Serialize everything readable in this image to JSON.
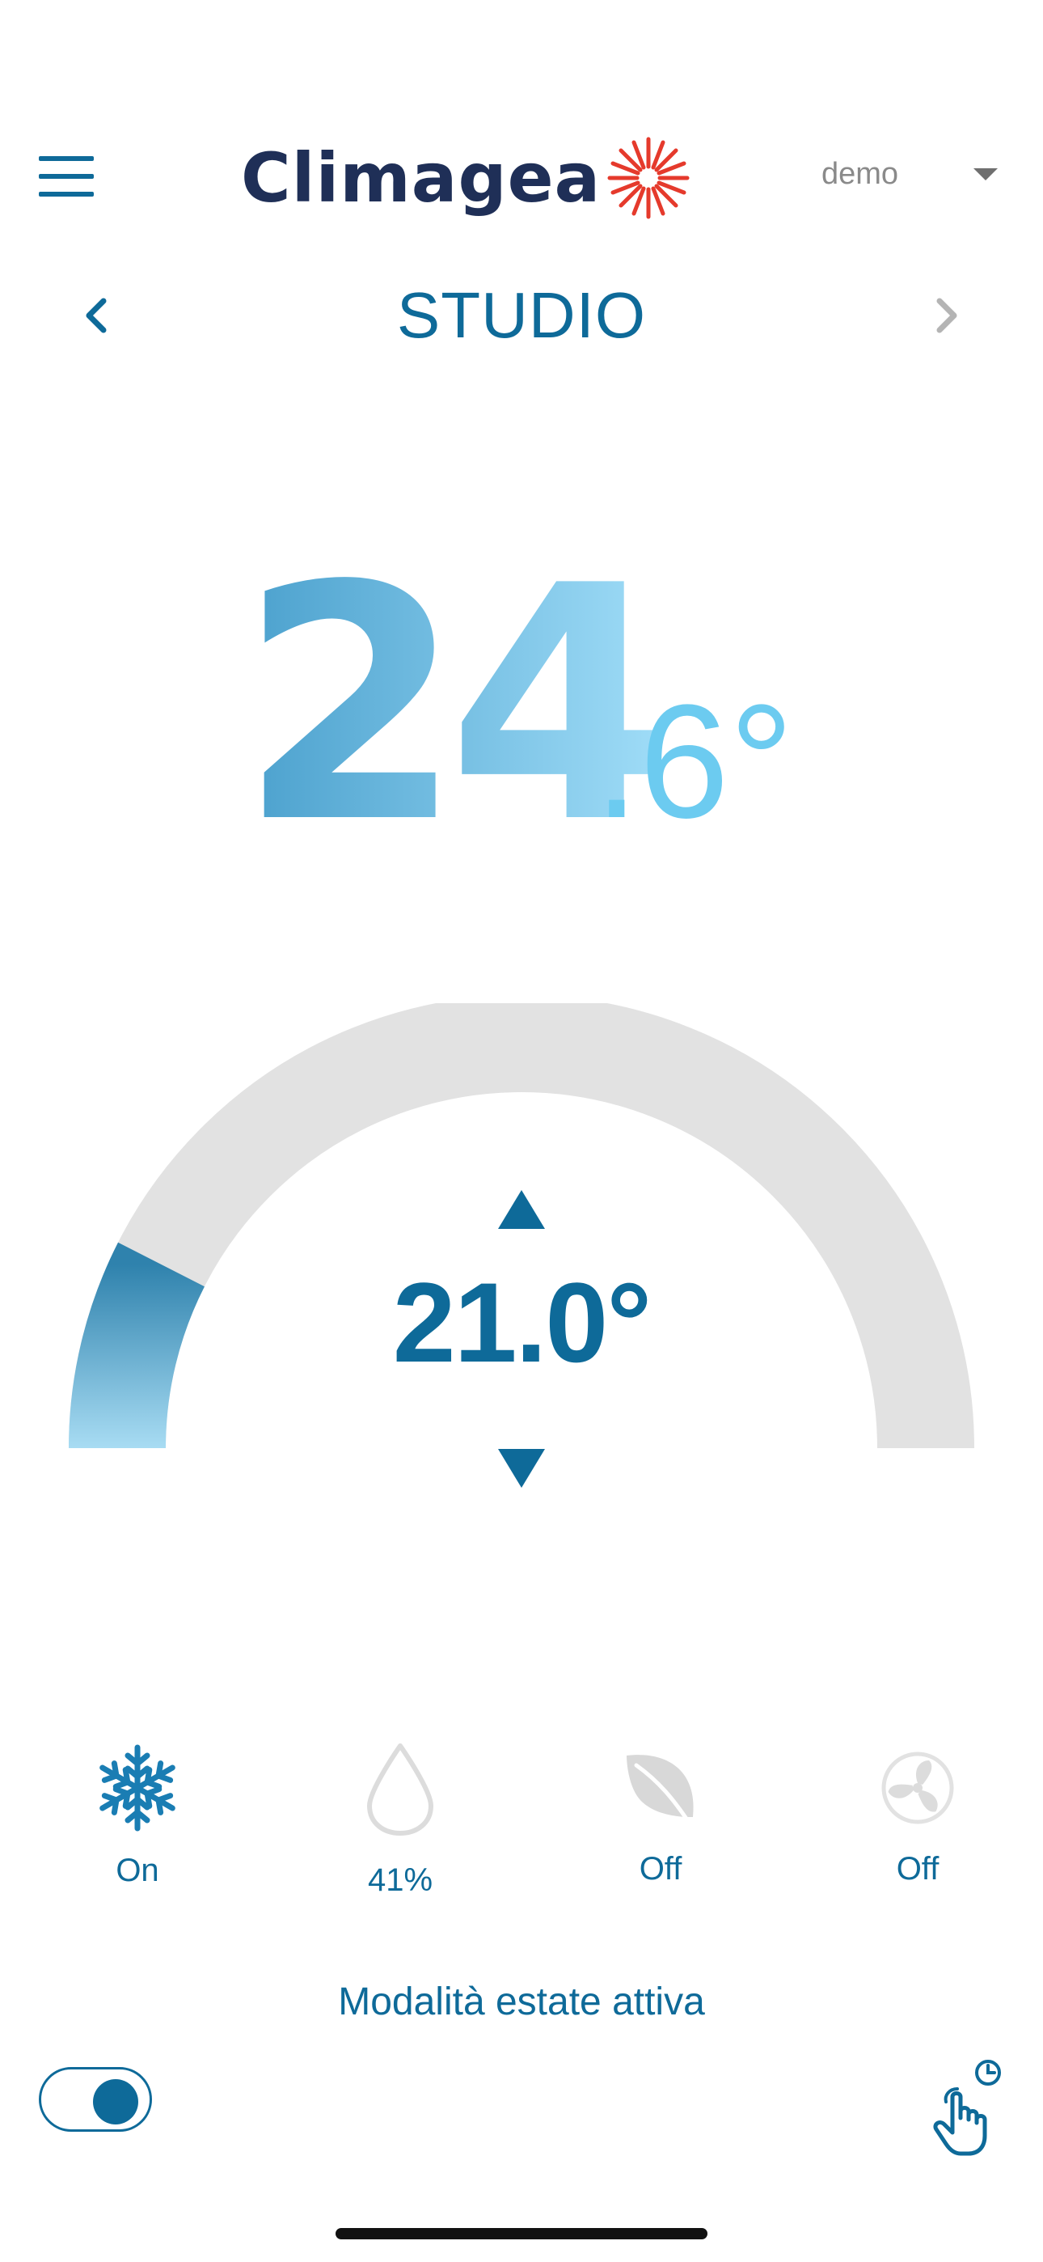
{
  "header": {
    "brand": "Climagea",
    "user": "demo"
  },
  "room": {
    "name": "STUDIO"
  },
  "current_temperature": {
    "integer": "24",
    "decimal": ".6°"
  },
  "setpoint": {
    "value": "21.0°",
    "level": 0.15
  },
  "status": {
    "cooling": "On",
    "humidity": "41%",
    "eco": "Off",
    "fan": "Off"
  },
  "mode_text": "Modalità estate attiva",
  "colors": {
    "primary": "#0e6a99",
    "brand_dark": "#1f2f57",
    "brand_sun": "#e53a2c",
    "temp_light": "#6ccbf0",
    "gauge_track": "#e2e2e2"
  },
  "icons": {
    "menu": "menu-icon",
    "prev": "chevron-left-icon",
    "next": "chevron-right-icon",
    "cooling": "snowflake-icon",
    "humidity": "droplet-icon",
    "eco": "leaf-icon",
    "fan": "fan-icon",
    "touch_timer": "touch-timer-icon"
  }
}
